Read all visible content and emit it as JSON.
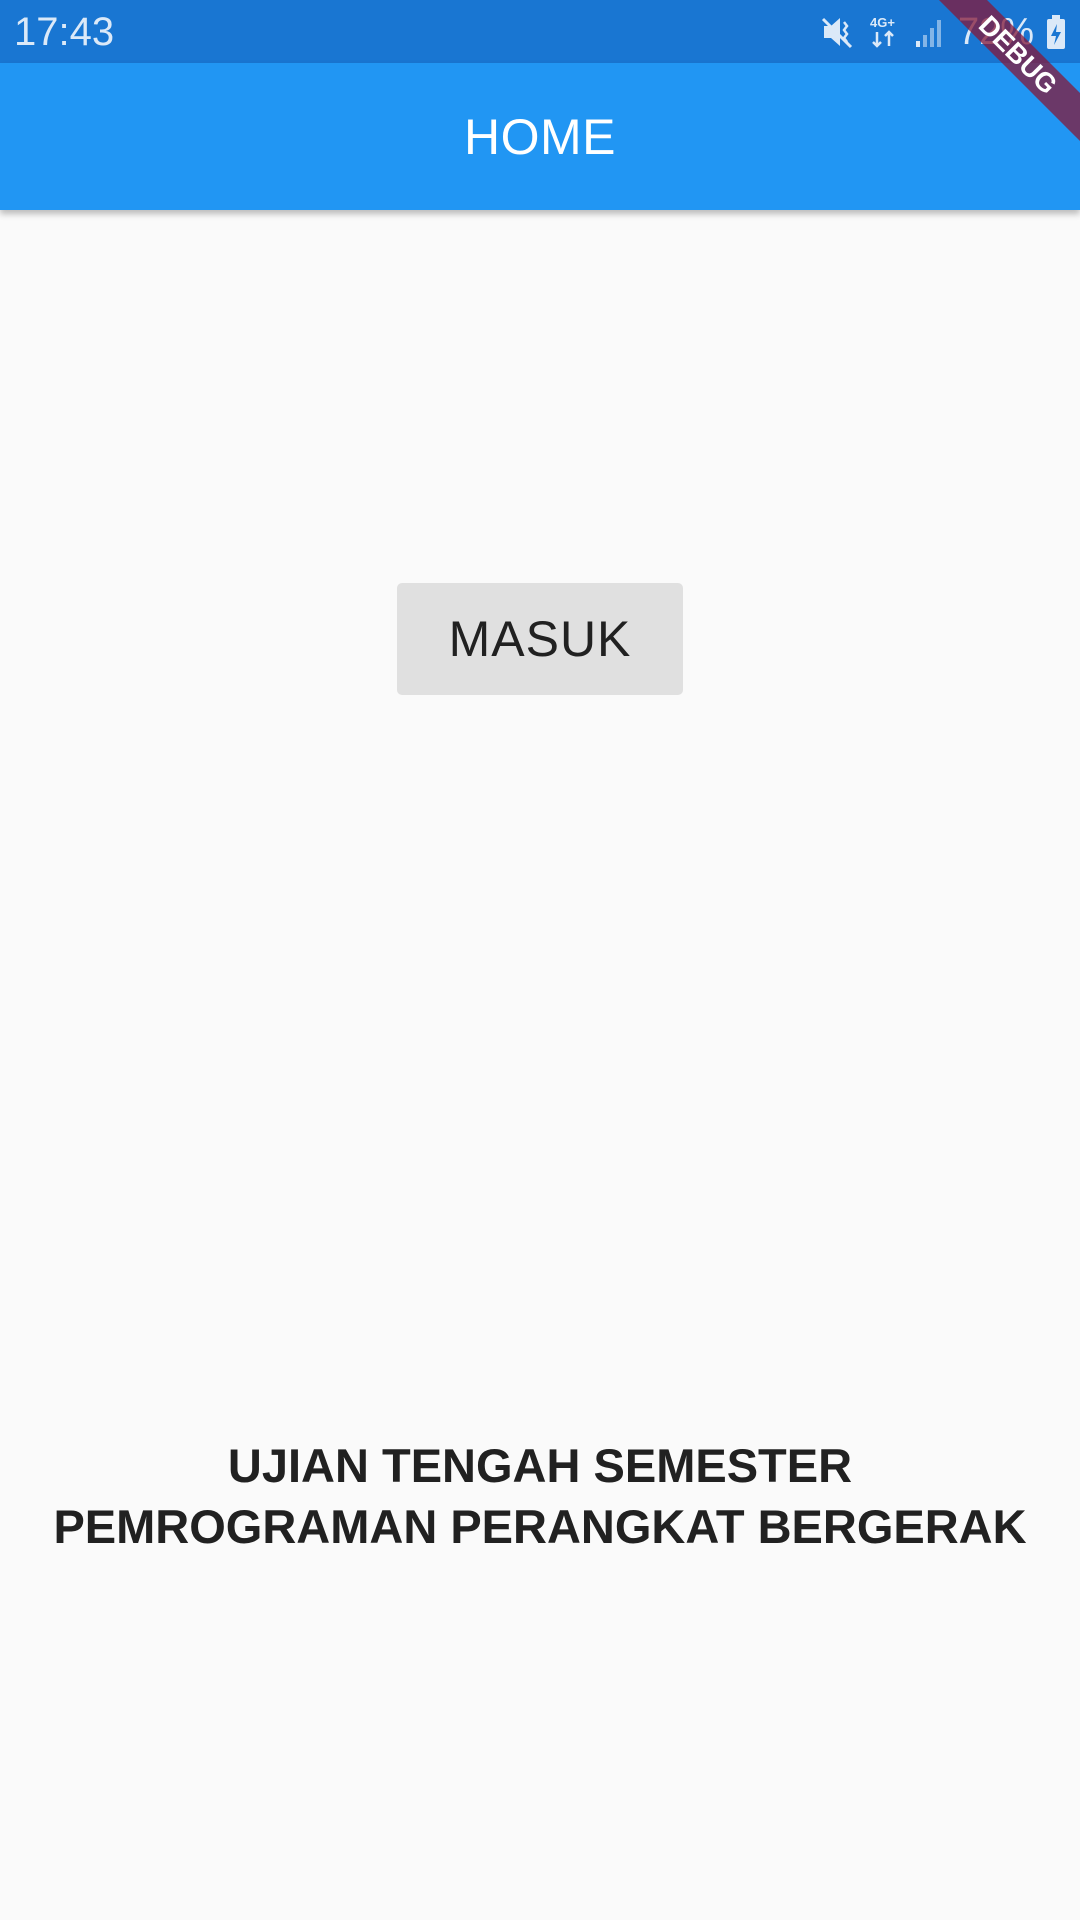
{
  "status_bar": {
    "time": "17:43",
    "network_label": "4G+",
    "battery_percent": "72%",
    "icons": [
      "mute-vibrate-icon",
      "network-4g-icon",
      "signal-icon",
      "battery-charging-icon"
    ]
  },
  "app_bar": {
    "title": "HOME",
    "color": "#2196f3"
  },
  "debug_banner": {
    "label": "DEBUG"
  },
  "main": {
    "button_label": "MASUK",
    "footer_lines": [
      "UJIAN TENGAH SEMESTER",
      "PEMROGRAMAN PERANGKAT BERGERAK"
    ]
  }
}
